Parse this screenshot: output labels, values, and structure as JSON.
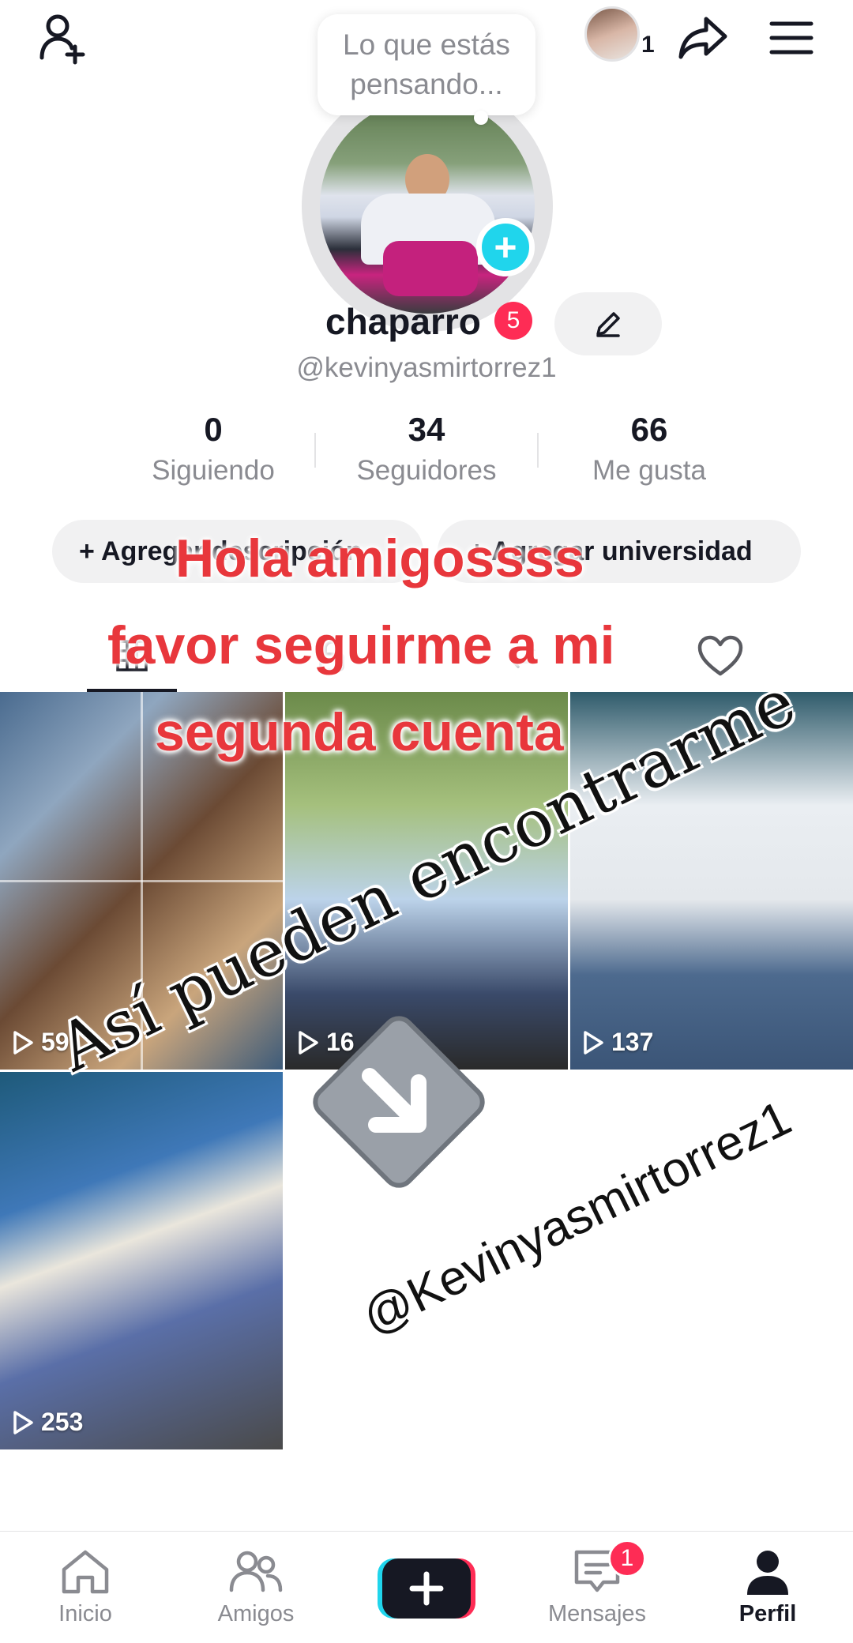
{
  "header": {
    "status_prompt": "Lo que estás pensando...",
    "story_count": "1"
  },
  "profile": {
    "display_name": "chaparro",
    "notification_badge": "5",
    "username": "@kevinyasmirtorrez1"
  },
  "stats": [
    {
      "value": "0",
      "label": "Siguiendo"
    },
    {
      "value": "34",
      "label": "Seguidores"
    },
    {
      "value": "66",
      "label": "Me gusta"
    }
  ],
  "chips": {
    "add_bio": "+ Agregar descripción",
    "add_university": "+ Agregar universidad"
  },
  "overlay": {
    "line1": "Hola amigossss",
    "line2": "favor seguirme a mi",
    "line3": "segunda cuenta",
    "diagonal": "Así pueden encontrarme",
    "handle": "@Kevinyasmirtorrez1"
  },
  "videos": [
    {
      "views": "59"
    },
    {
      "views": "16"
    },
    {
      "views": "137"
    },
    {
      "views": "253"
    }
  ],
  "bottom_nav": {
    "home": "Inicio",
    "friends": "Amigos",
    "messages": "Mensajes",
    "messages_badge": "1",
    "profile": "Perfil"
  },
  "colors": {
    "accent_pink": "#fe2c55",
    "accent_cyan": "#20d5ec",
    "caption_red": "#e8373c",
    "text_primary": "#161823",
    "text_secondary": "#8a8b91"
  },
  "icons": [
    "add-user-icon",
    "share-icon",
    "menu-icon",
    "edit-icon",
    "play-icon",
    "heart-icon",
    "home-icon",
    "friends-icon",
    "messages-icon",
    "profile-icon"
  ]
}
